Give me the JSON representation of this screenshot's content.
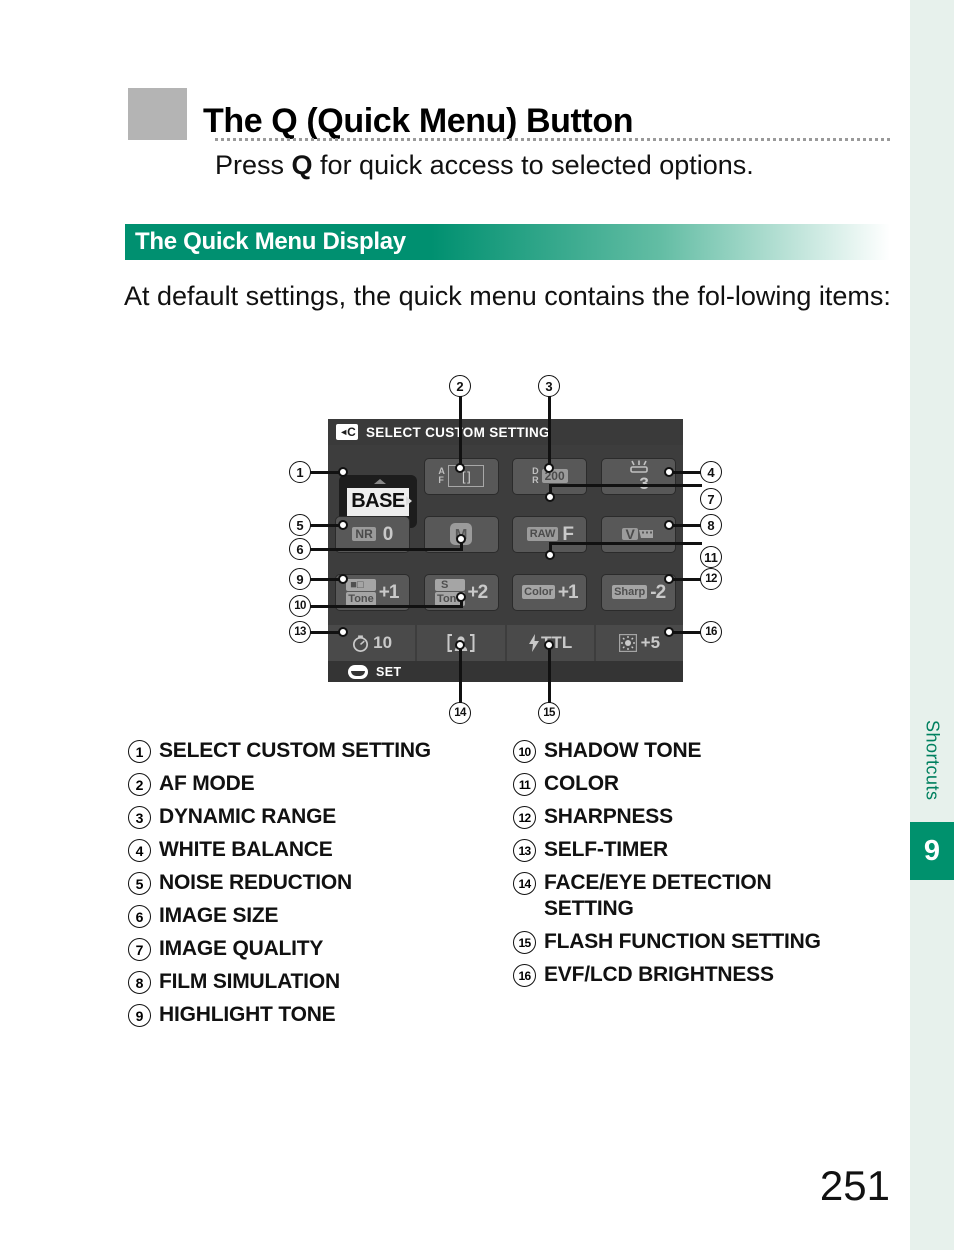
{
  "page": {
    "number": "251",
    "chapter_number": "9",
    "chapter_name": "Shortcuts"
  },
  "header": {
    "title": "The Q (Quick Menu) Button",
    "subtitle_prefix": "Press ",
    "subtitle_bold": "Q",
    "subtitle_suffix": " for quick access to selected options."
  },
  "section": {
    "title": "The Quick Menu Display",
    "intro": "At default settings, the quick menu contains the fol-lowing items:"
  },
  "lcd": {
    "header_icon": "back-c-icon",
    "header_icon_text": "C",
    "header_title": "SELECT CUSTOM SETTING",
    "footer_icon": "menu-dial-icon",
    "footer_label": "SET",
    "selector_value": "BASE",
    "tiles": [
      {
        "id": "af-mode",
        "icon": "af-bracket-icon",
        "label_small": "AF",
        "value": "[ ]"
      },
      {
        "id": "dynamic-range",
        "icon": "dynamic-range-icon",
        "label_small": "DR",
        "value": "200"
      },
      {
        "id": "white-balance",
        "icon": "fluorescent-lamp-icon",
        "label_small": "",
        "value": "3"
      },
      {
        "id": "noise-reduction",
        "icon": "nr-icon",
        "label_small": "NR",
        "value": "0"
      },
      {
        "id": "image-size",
        "icon": "image-size-m-icon",
        "label_small": "",
        "value": "M"
      },
      {
        "id": "image-quality",
        "icon": "raw-icon",
        "label_small": "RAW",
        "value": "F"
      },
      {
        "id": "film-simulation",
        "icon": "film-roll-v-icon",
        "label_small": "",
        "value": "V"
      },
      {
        "id": "highlight-tone",
        "icon": "highlight-tone-icon",
        "label_small": "H Tone",
        "value": "+1"
      },
      {
        "id": "shadow-tone",
        "icon": "shadow-tone-icon",
        "label_small": "S Tone",
        "value": "+2"
      },
      {
        "id": "color",
        "icon": "color-icon",
        "label_small": "Color",
        "value": "+1"
      },
      {
        "id": "sharpness",
        "icon": "sharpness-icon",
        "label_small": "Sharp",
        "value": "-2"
      }
    ],
    "strip": [
      {
        "id": "self-timer",
        "icon": "self-timer-icon",
        "value": "10"
      },
      {
        "id": "face-detection",
        "icon": "face-detection-icon",
        "value": ""
      },
      {
        "id": "flash-function",
        "icon": "flash-icon",
        "value": "TTL"
      },
      {
        "id": "evf-brightness",
        "icon": "brightness-sun-icon",
        "value": "+5"
      }
    ]
  },
  "callouts": [
    "1",
    "2",
    "3",
    "4",
    "5",
    "6",
    "7",
    "8",
    "9",
    "10",
    "11",
    "12",
    "13",
    "14",
    "15",
    "16"
  ],
  "legend": {
    "left": [
      {
        "num": "1",
        "text": "SELECT CUSTOM SETTING"
      },
      {
        "num": "2",
        "text": "AF MODE"
      },
      {
        "num": "3",
        "text": "DYNAMIC RANGE"
      },
      {
        "num": "4",
        "text": "WHITE BALANCE"
      },
      {
        "num": "5",
        "text": "NOISE REDUCTION"
      },
      {
        "num": "6",
        "text": "IMAGE SIZE"
      },
      {
        "num": "7",
        "text": "IMAGE QUALITY"
      },
      {
        "num": "8",
        "text": "FILM SIMULATION"
      },
      {
        "num": "9",
        "text": "HIGHLIGHT TONE"
      }
    ],
    "right": [
      {
        "num": "10",
        "text": "SHADOW TONE"
      },
      {
        "num": "11",
        "text": "COLOR"
      },
      {
        "num": "12",
        "text": "SHARPNESS"
      },
      {
        "num": "13",
        "text": "SELF-TIMER"
      },
      {
        "num": "14",
        "text": "FACE/EYE DETECTION",
        "cont": "SETTING"
      },
      {
        "num": "15",
        "text": "FLASH FUNCTION SETTING"
      },
      {
        "num": "16",
        "text": "EVF/LCD BRIGHTNESS"
      }
    ]
  },
  "colors": {
    "accent_green": "#00916d",
    "edge_tint": "#e7f1ec",
    "head_square": "#b4b4b4",
    "lcd_bg": "#3d3d3d",
    "tile_bg": "#585858"
  }
}
